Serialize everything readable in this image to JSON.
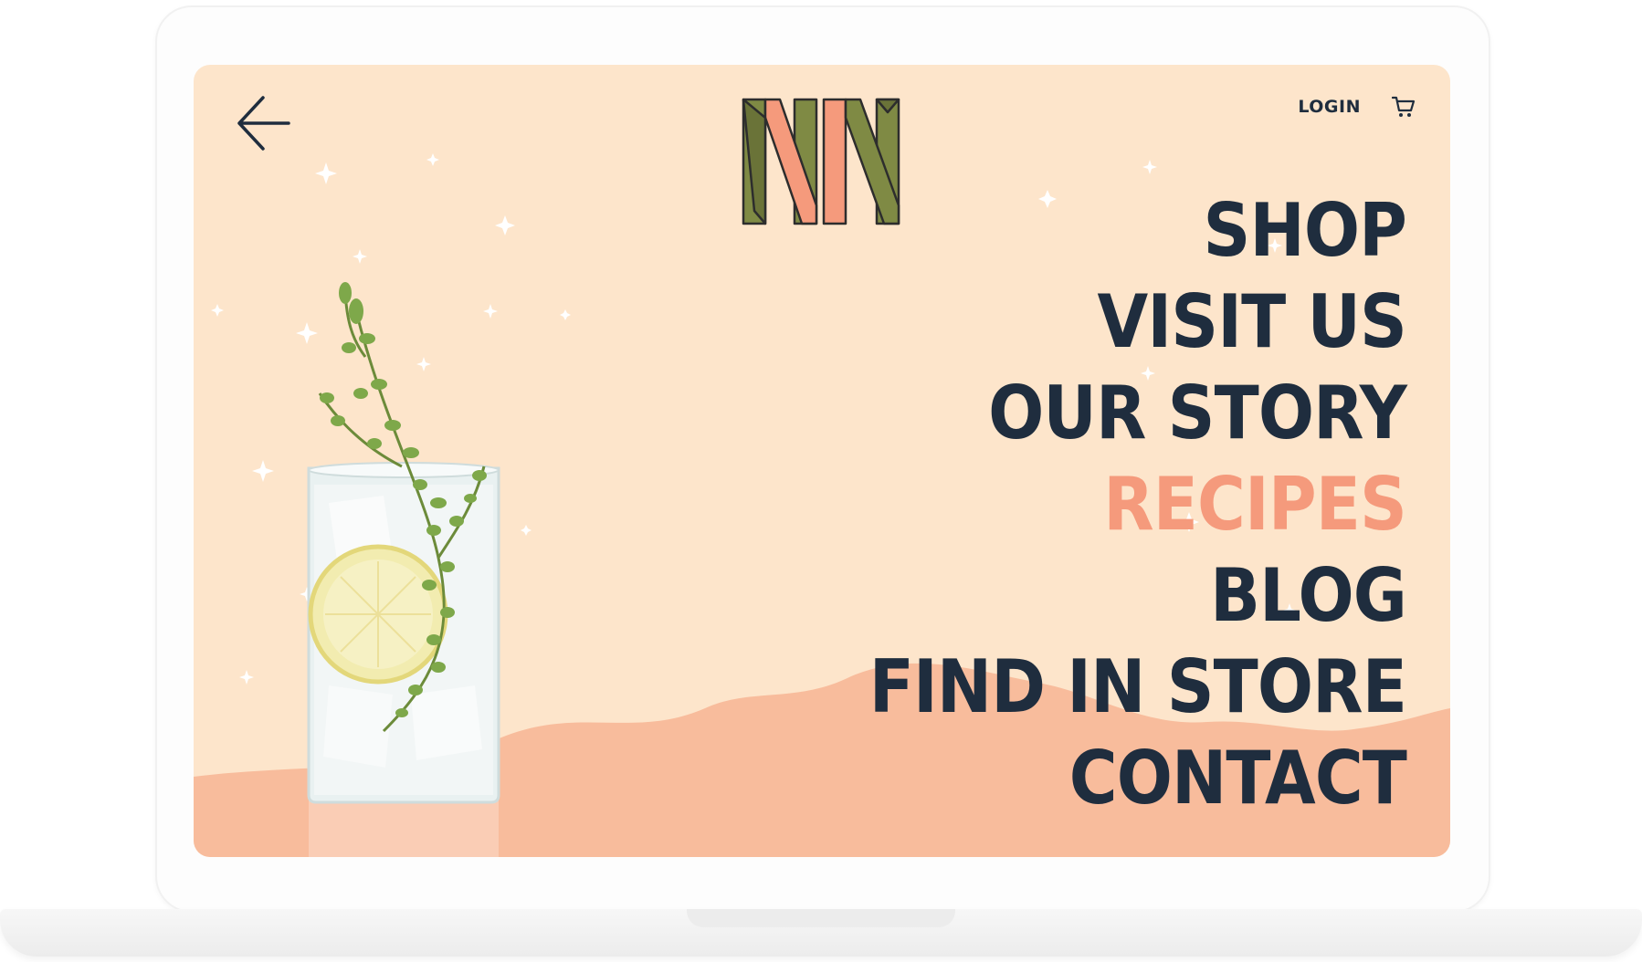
{
  "header": {
    "back_icon": "arrow-left-icon",
    "logo_icon": "nn-logo-icon",
    "login_label": "LOGIN",
    "cart_icon": "shopping-cart-icon"
  },
  "nav": {
    "items": [
      {
        "label": "SHOP",
        "active": false
      },
      {
        "label": "VISIT US",
        "active": false
      },
      {
        "label": "OUR STORY",
        "active": false
      },
      {
        "label": "RECIPES",
        "active": true
      },
      {
        "label": "BLOG",
        "active": false
      },
      {
        "label": "FIND IN STORE",
        "active": false
      },
      {
        "label": "CONTACT",
        "active": false
      }
    ]
  },
  "colors": {
    "background": "#fde5cb",
    "hills": "#f8bc9c",
    "text": "#1f2d3e",
    "active": "#f59a7c",
    "logo_olive": "#7f8a44",
    "logo_coral": "#f59a7c"
  },
  "image": {
    "subject": "glass-with-lemon-and-thyme-icon"
  }
}
